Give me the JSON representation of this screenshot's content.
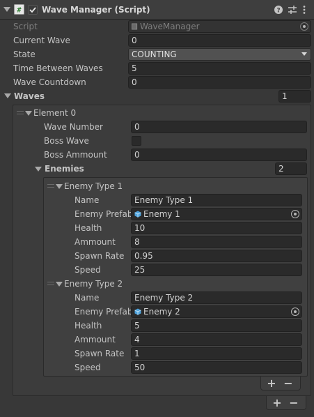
{
  "component": {
    "title": "Wave Manager (Script)",
    "icon": "csharp-script-icon",
    "enabled": true,
    "header_icons": [
      "help-icon",
      "preset-sliders-icon",
      "more-options-icon"
    ]
  },
  "fields": {
    "script": {
      "label": "Script",
      "value": "WaveManager"
    },
    "current_wave": {
      "label": "Current Wave",
      "value": "0"
    },
    "state": {
      "label": "State",
      "value": "COUNTING"
    },
    "time_between_waves": {
      "label": "Time Between Waves",
      "value": "5"
    },
    "wave_countdown": {
      "label": "Wave Countdown",
      "value": "0"
    }
  },
  "waves": {
    "label": "Waves",
    "size": "1",
    "add_label": "+",
    "remove_label": "−",
    "elements": [
      {
        "label": "Element 0",
        "wave_number": {
          "label": "Wave Number",
          "value": "0"
        },
        "boss_wave": {
          "label": "Boss Wave",
          "checked": false
        },
        "boss_ammount": {
          "label": "Boss Ammount",
          "value": "0"
        },
        "enemies": {
          "label": "Enemies",
          "size": "2",
          "add_label": "+",
          "remove_label": "−",
          "items": [
            {
              "label": "Enemy Type 1",
              "name": {
                "label": "Name",
                "value": "Enemy Type 1"
              },
              "prefab": {
                "label": "Enemy Prefab",
                "value": "Enemy 1"
              },
              "health": {
                "label": "Health",
                "value": "10"
              },
              "ammount": {
                "label": "Ammount",
                "value": "8"
              },
              "spawn_rate": {
                "label": "Spawn Rate",
                "value": "0.95"
              },
              "speed": {
                "label": "Speed",
                "value": "25"
              }
            },
            {
              "label": "Enemy Type 2",
              "name": {
                "label": "Name",
                "value": "Enemy Type 2"
              },
              "prefab": {
                "label": "Enemy Prefab",
                "value": "Enemy 2"
              },
              "health": {
                "label": "Health",
                "value": "5"
              },
              "ammount": {
                "label": "Ammount",
                "value": "4"
              },
              "spawn_rate": {
                "label": "Spawn Rate",
                "value": "1"
              },
              "speed": {
                "label": "Speed",
                "value": "50"
              }
            }
          ]
        }
      }
    ]
  },
  "colors": {
    "background": "#383838",
    "field": "#2a2a2a",
    "prefab_icon": "#4fa3dd"
  }
}
